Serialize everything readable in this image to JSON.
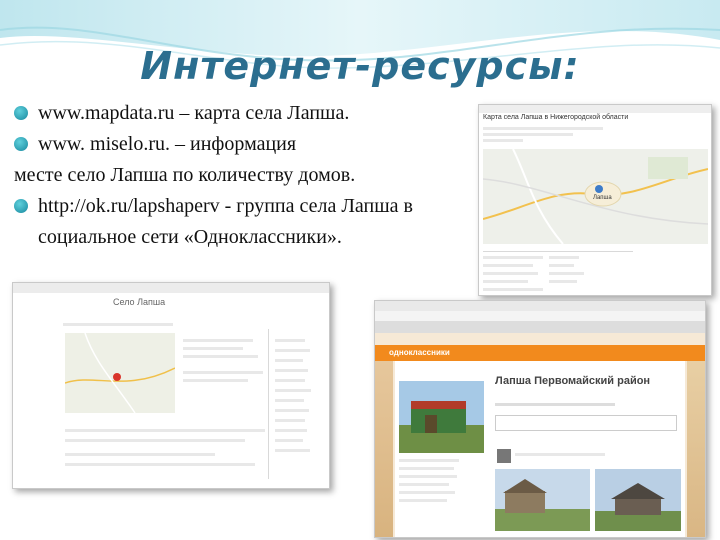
{
  "slide": {
    "title": "Интернет-ресурсы:",
    "items": [
      {
        "bullet": true,
        "text": "www.mapdata.ru – карта села Лапша."
      },
      {
        "bullet": true,
        "text": "www. miselo.ru. – информация"
      },
      {
        "bullet": false,
        "text": "месте село Лапша по количеству домов."
      },
      {
        "bullet": true,
        "text": "http://ok.ru/lapshaperv - группа села Лапша в"
      },
      {
        "bullet": false,
        "indent": true,
        "text": "социальное сети «Одноклассники»."
      }
    ]
  },
  "screenshots": {
    "map_site": {
      "heading": "Карта села Лапша в Нижегородской области",
      "marker_label": "Лапша"
    },
    "info_site": {
      "heading": "Село Лапша"
    },
    "ok_site": {
      "group_title": "Лапша Первомайский район",
      "brand": "одноклассники"
    }
  },
  "colors": {
    "title": "#2b6e8f",
    "bullet": "#17889e",
    "ok_orange": "#f28a1d"
  }
}
